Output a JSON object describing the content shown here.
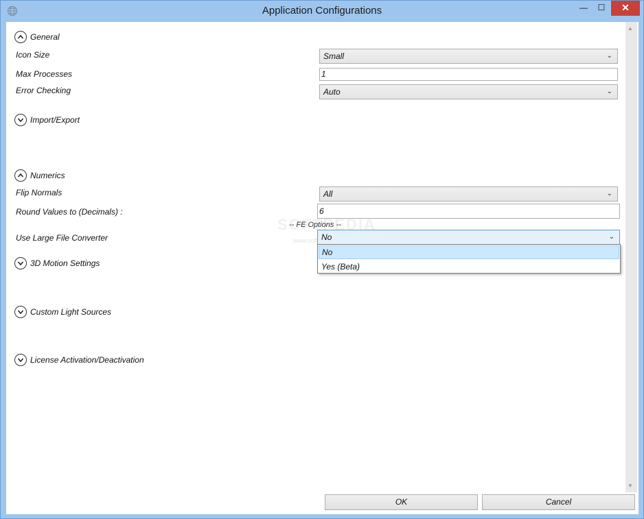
{
  "window": {
    "title": "Application Configurations",
    "icon": "globe-icon",
    "controls": {
      "minimize": "—",
      "maximize": "☐",
      "close": "✕"
    }
  },
  "sections": {
    "general": {
      "label": "General",
      "expanded": true
    },
    "import_export": {
      "label": "Import/Export",
      "expanded": false
    },
    "numerics": {
      "label": "Numerics",
      "expanded": true
    },
    "motion_3d": {
      "label": "3D Motion Settings",
      "expanded": false
    },
    "light_sources": {
      "label": "Custom Light Sources",
      "expanded": false
    },
    "license": {
      "label": "License Activation/Deactivation",
      "expanded": false
    }
  },
  "general": {
    "icon_size": {
      "label": "Icon Size",
      "value": "Small"
    },
    "max_processes": {
      "label": "Max Processes",
      "value": "1"
    },
    "error_checking": {
      "label": "Error Checking",
      "value": "Auto"
    }
  },
  "numerics": {
    "flip_normals": {
      "label": "Flip Normals",
      "value": "All"
    },
    "round_values": {
      "label": "Round Values to (Decimals) :",
      "value": "6"
    },
    "fe_options_label": "-- FE Options --",
    "large_file_converter": {
      "label": "Use Large File Converter",
      "value": "No",
      "options": [
        "No",
        "Yes (Beta)"
      ]
    }
  },
  "watermark": {
    "text": "SOFTPEDIA",
    "sub": "www.softpedia.com"
  },
  "buttons": {
    "ok": "OK",
    "cancel": "Cancel"
  },
  "colors": {
    "accent": "#9ec5ee",
    "close": "#c7413a",
    "selection": "#cce8ff"
  }
}
